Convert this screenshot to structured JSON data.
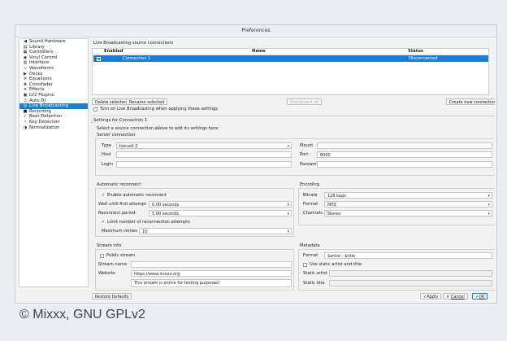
{
  "window": {
    "title": "Preferences"
  },
  "sidebar": {
    "items": [
      {
        "label": "Sound Hardware",
        "icon": "speaker-icon",
        "sub": false,
        "selected": false
      },
      {
        "label": "Library",
        "icon": "library-icon",
        "sub": false,
        "selected": false
      },
      {
        "label": "Controllers",
        "icon": "controller-icon",
        "sub": false,
        "selected": false
      },
      {
        "label": "Vinyl Control",
        "icon": "vinyl-icon",
        "sub": false,
        "selected": false
      },
      {
        "label": "Interface",
        "icon": "interface-icon",
        "sub": false,
        "selected": false
      },
      {
        "label": "Waveforms",
        "icon": "waveform-icon",
        "sub": false,
        "selected": false
      },
      {
        "label": "Decks",
        "icon": "deck-icon",
        "sub": false,
        "selected": false
      },
      {
        "label": "Equalizers",
        "icon": "equalizer-icon",
        "sub": false,
        "selected": false
      },
      {
        "label": "Crossfader",
        "icon": "crossfader-icon",
        "sub": false,
        "selected": false
      },
      {
        "label": "Effects",
        "icon": "effects-icon",
        "sub": false,
        "selected": false
      },
      {
        "label": "LV2 Plugins",
        "icon": "plugin-icon",
        "sub": false,
        "selected": false
      },
      {
        "label": "Auto DJ",
        "icon": "autodj-icon",
        "sub": false,
        "selected": false
      },
      {
        "label": "Live Broadcasting",
        "icon": "broadcast-icon",
        "sub": false,
        "selected": true
      },
      {
        "label": "Recording",
        "icon": "recording-icon",
        "sub": false,
        "selected": false
      },
      {
        "label": "Beat Detection",
        "icon": "beat-icon",
        "sub": false,
        "selected": false
      },
      {
        "label": "Key Detection",
        "icon": "key-icon",
        "sub": false,
        "selected": false
      },
      {
        "label": "Normalization",
        "icon": "normalization-icon",
        "sub": false,
        "selected": false
      }
    ]
  },
  "connections": {
    "title": "Live Broadcasting source connections",
    "headers": {
      "enabled": "Enabled",
      "name": "Name",
      "status": "Status"
    },
    "rows": [
      {
        "enabled": "✓",
        "name": "Connection 1",
        "status": "Disconnected"
      }
    ],
    "delete_label": "Delete selected",
    "rename_label": "Rename selected",
    "disconnect_label": "Disconnect all",
    "create_label": "Create new connection",
    "turn_on_label": "Turn on Live Broadcasting when applying these settings"
  },
  "settings": {
    "title": "Settings for Connection 1",
    "hint": "Select a source connection above to edit its settings here",
    "server": {
      "title": "Server connection",
      "type_label": "Type",
      "type_value": "Icecast 2",
      "host_label": "Host",
      "host_value": "",
      "login_label": "Login",
      "login_value": "",
      "mount_label": "Mount",
      "mount_value": "",
      "port_label": "Port",
      "port_value": "8000",
      "password_label": "Password",
      "password_value": ""
    },
    "reconnect": {
      "title": "Automatic reconnect",
      "enable_label": "Enable automatic reconnect",
      "wait_label": "Wait until first attempt",
      "wait_value": "0.00 seconds",
      "period_label": "Reconnect period",
      "period_value": "5.00 seconds",
      "limit_label": "Limit number of reconnection attempts",
      "max_label": "Maximum retries",
      "max_value": "10"
    },
    "encoding": {
      "title": "Encoding",
      "bitrate_label": "Bitrate",
      "bitrate_value": "128 kbps",
      "format_label": "Format",
      "format_value": "MP3",
      "channels_label": "Channels",
      "channels_value": "Stereo"
    },
    "stream": {
      "title": "Stream info",
      "public_label": "Public stream",
      "name_label": "Stream name",
      "name_value": "",
      "website_label": "Website",
      "website_value": "https://www.mixxx.org",
      "desc_value": "This stream is online for testing purposes!"
    },
    "metadata": {
      "title": "Metadata",
      "format_label": "Format",
      "format_value": "$artist - $title",
      "static_label": "Use static artist and title",
      "artist_label": "Static artist",
      "title_label": "Static title"
    }
  },
  "footer": {
    "restore_label": "Restore Defaults",
    "apply_label": "Apply",
    "cancel_label": "Cancel",
    "ok_label": "OK"
  },
  "caption": "© Mixxx, GNU GPLv2",
  "colors": {
    "accent": "#1a7fd0",
    "background": "#e9eef2"
  }
}
